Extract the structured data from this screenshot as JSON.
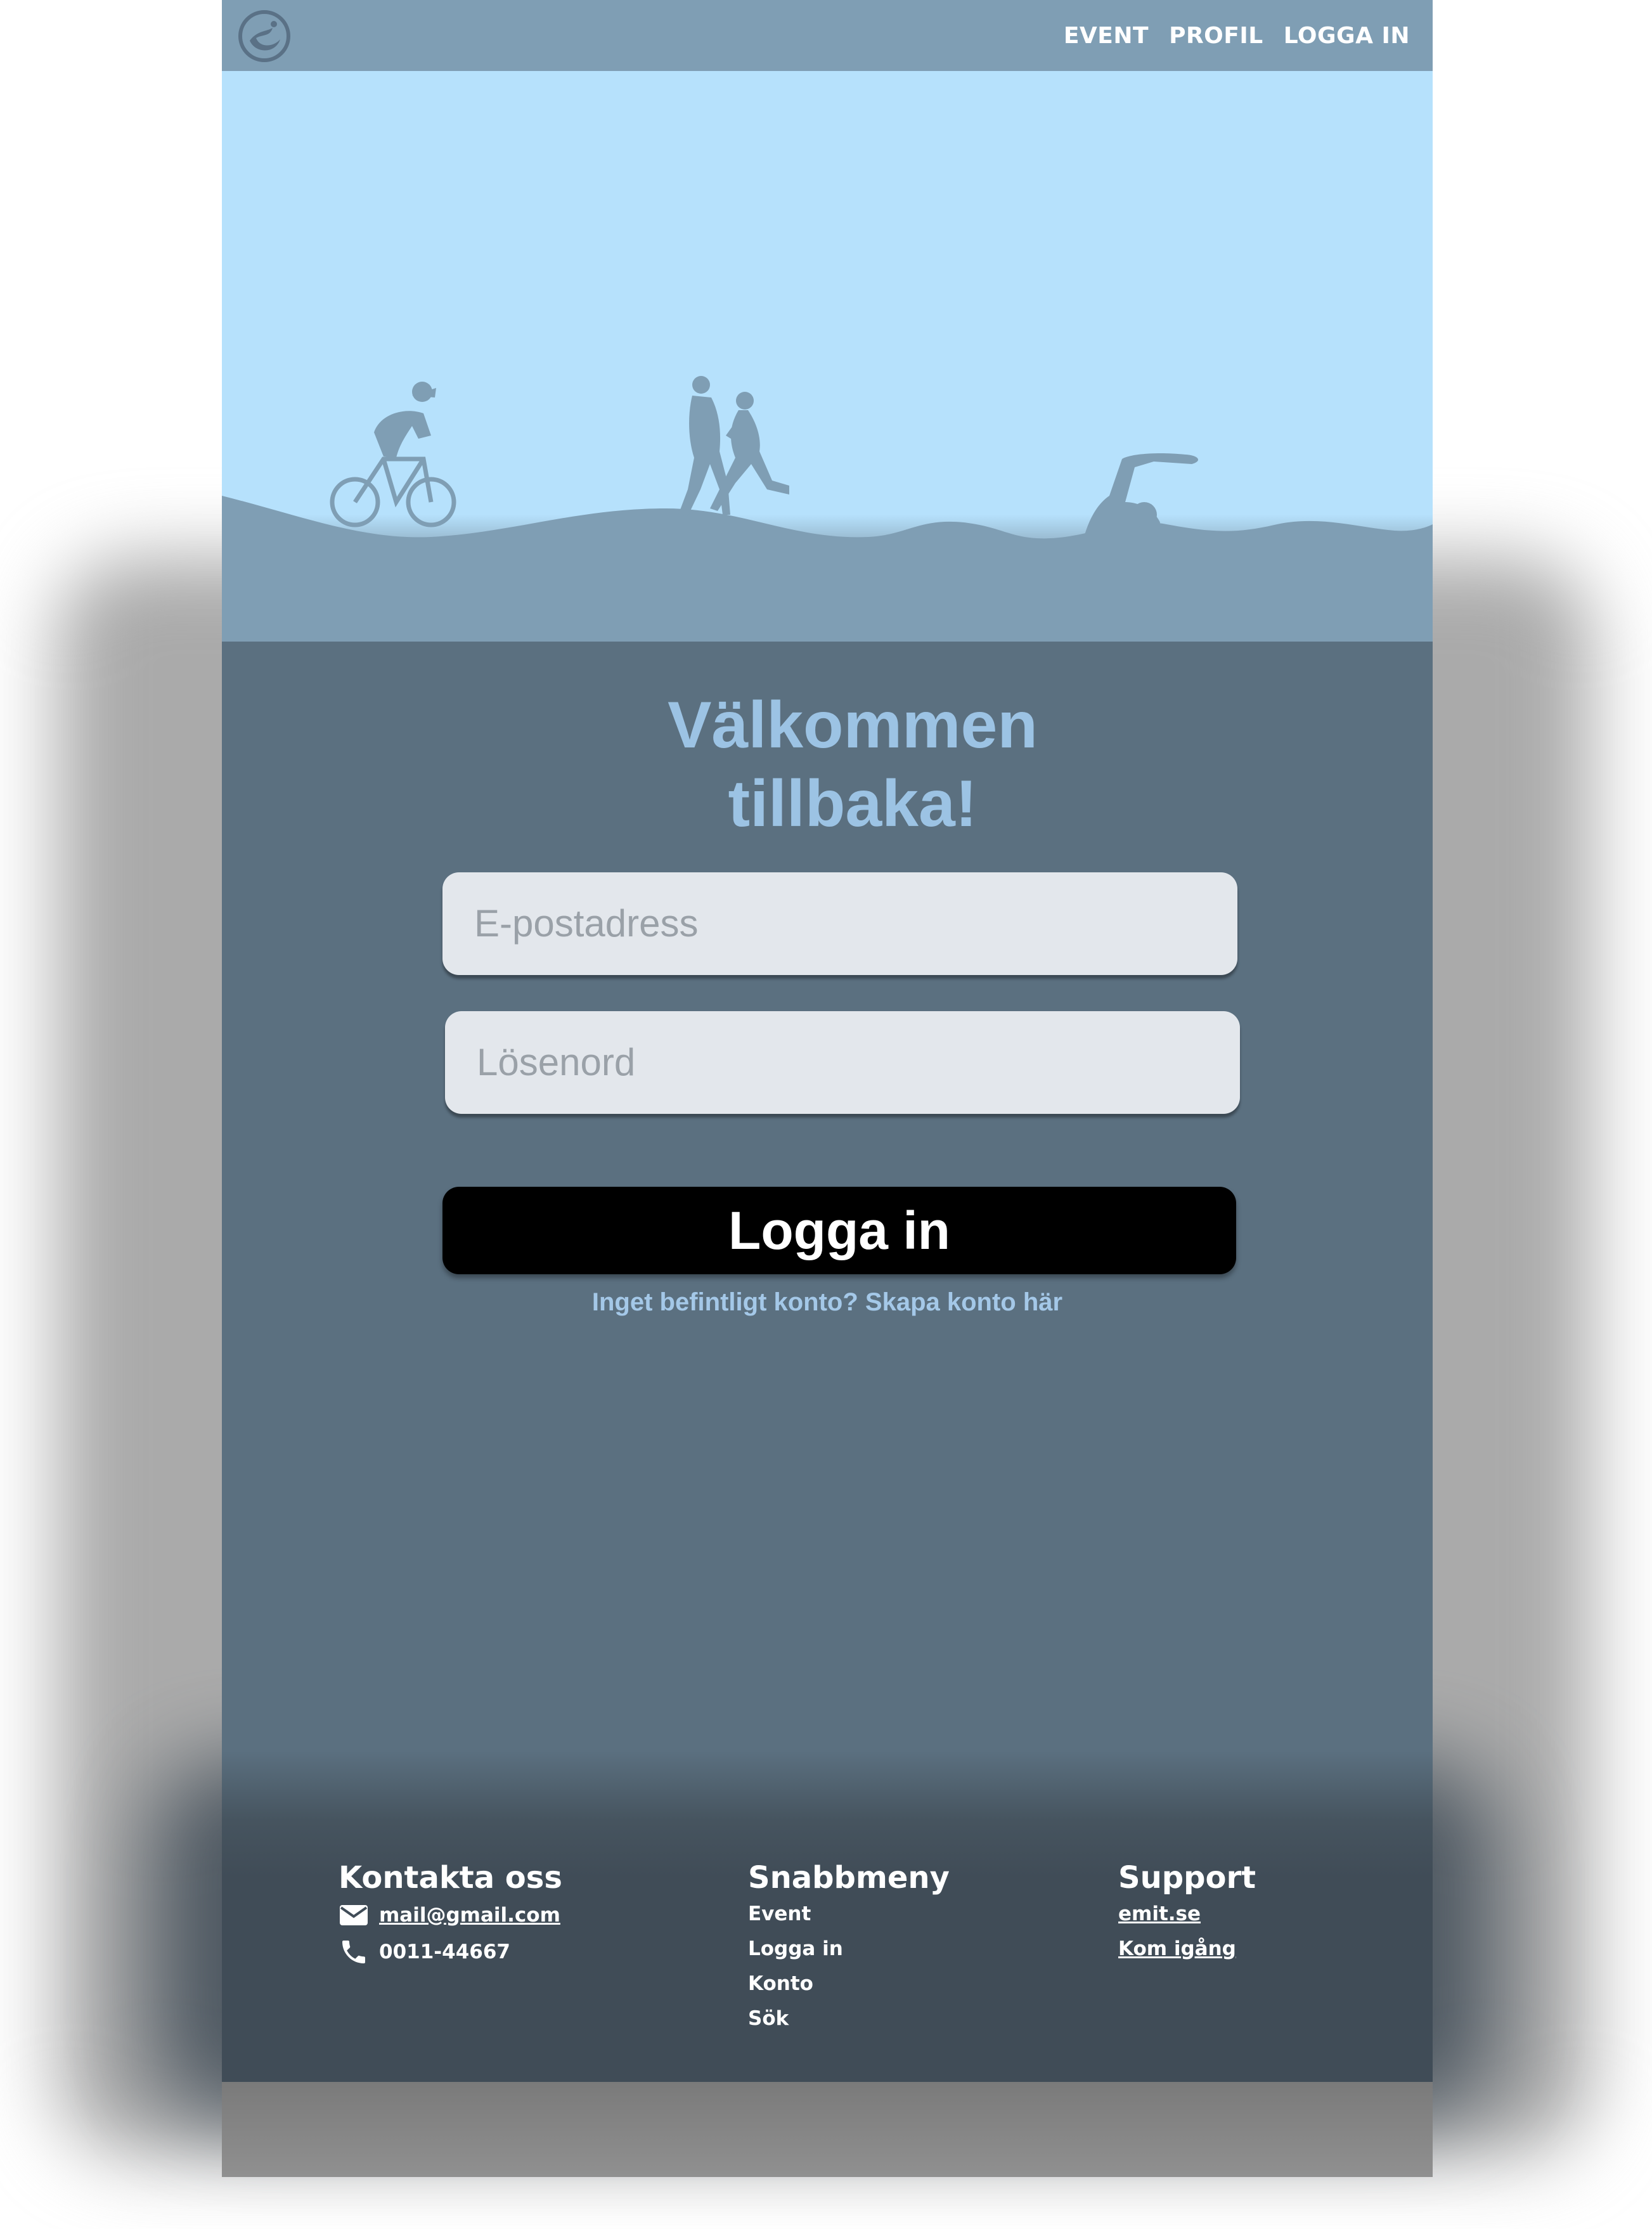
{
  "nav": {
    "links": [
      "EVENT",
      "PROFIL",
      "LOGGA IN"
    ]
  },
  "login": {
    "title_line1": "Välkommen",
    "title_line2": "tillbaka!",
    "email_placeholder": "E-postadress",
    "password_placeholder": "Lösenord",
    "submit_label": "Logga in",
    "signup_text": "Inget befintligt konto? Skapa konto här"
  },
  "footer": {
    "contact": {
      "heading": "Kontakta oss",
      "email": "mail@gmail.com",
      "phone": "0011-44667"
    },
    "quickmenu": {
      "heading": "Snabbmeny",
      "items": [
        "Event",
        "Logga in",
        "Konto",
        "Sök"
      ]
    },
    "support": {
      "heading": "Support",
      "links": [
        "emit.se",
        "Kom igång"
      ]
    }
  },
  "colors": {
    "nav_bg": "#7f9eb4",
    "sky": "#b6e1fc",
    "main_bg": "#5b7080",
    "footer_bg": "#404c57",
    "accent_text": "#9cc3e4",
    "button_bg": "#000000"
  }
}
